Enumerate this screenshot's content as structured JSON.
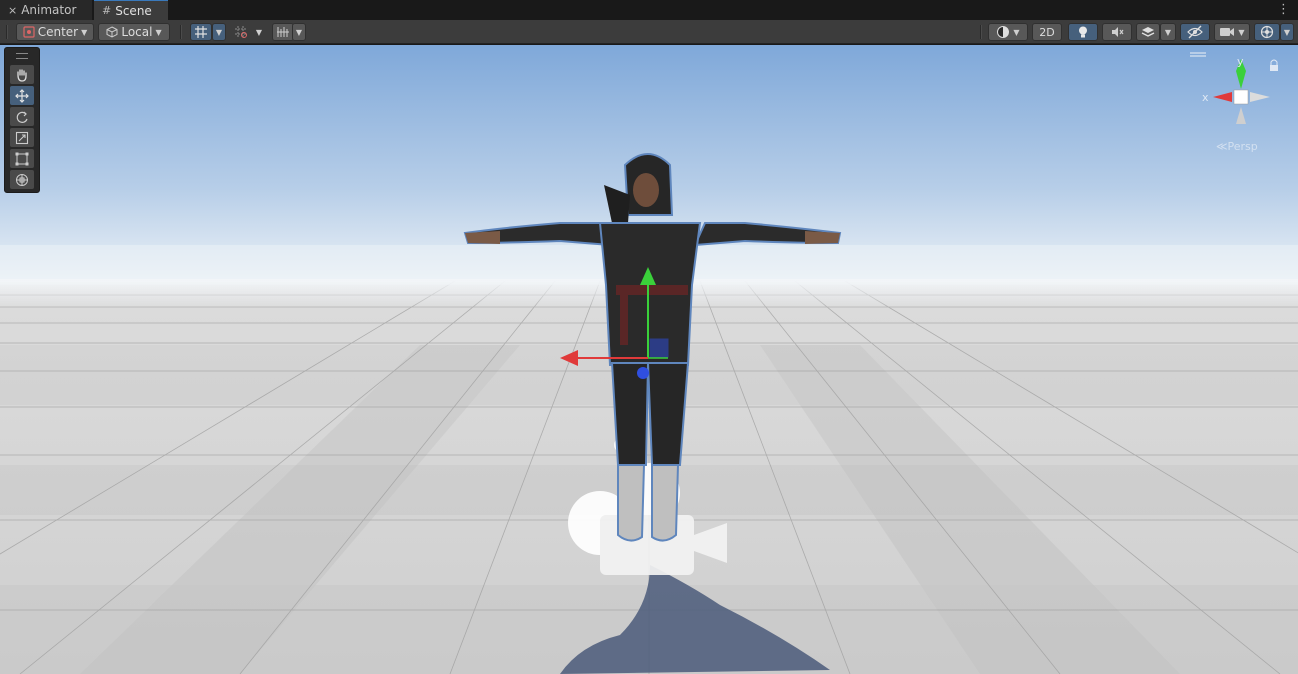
{
  "tabs": [
    {
      "label": "Animator",
      "icon": "animator-icon"
    },
    {
      "label": "Scene",
      "icon": "scene-grid-icon"
    }
  ],
  "toolbar": {
    "pivot_label": "Center",
    "space_label": "Local",
    "mode_2d_label": "2D"
  },
  "tools": [
    "hand-tool",
    "move-tool",
    "rotate-tool",
    "scale-tool",
    "rect-tool",
    "transform-tool"
  ],
  "active_tool": "move-tool",
  "gizmo": {
    "y_label": "y",
    "x_label": "x",
    "projection_label": "Persp"
  },
  "colors": {
    "sky_top": "#8eb4e1",
    "sky_horizon": "#e6eef5",
    "ground": "#cfcfcf",
    "axis_x": "#e03a3a",
    "axis_y": "#3ad03a",
    "axis_z": "#2f4fe0",
    "accent": "#46607c"
  }
}
